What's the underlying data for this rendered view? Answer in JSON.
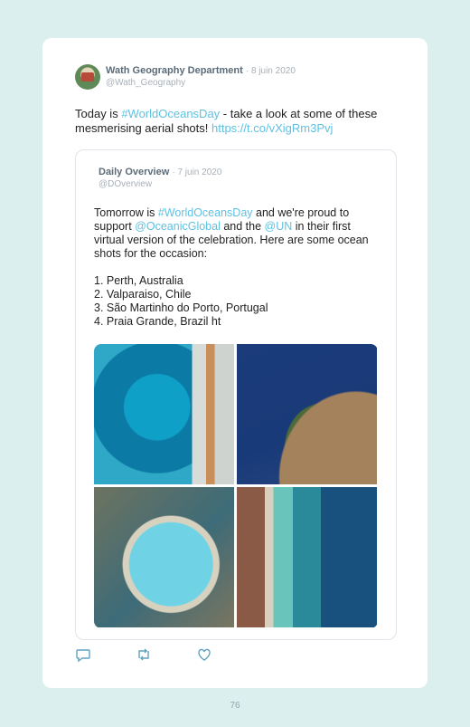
{
  "tweet": {
    "author_name": "Wath Geography Department",
    "date": "· 8 juin 2020",
    "handle": "@Wath_Geography",
    "text_1": "Today is ",
    "hashtag": "#WorldOceansDay",
    "text_2": " - take a look at some of these mesmerising aerial shots! ",
    "link": "https://t.co/vXigRm3Pvj"
  },
  "quoted": {
    "author_name": "Daily Overview",
    "date": "· 7 juin 2020",
    "handle": "@DOverview",
    "text_1": "Tomorrow is ",
    "hashtag": "#WorldOceansDay",
    "text_2": " and we're proud to support ",
    "mention_1": "@OceanicGlobal",
    "text_3": " and the ",
    "mention_2": "@UN",
    "text_4": " in their first virtual version of the celebration. Here are some ocean shots for the occasion:",
    "list": [
      "1. Perth, Australia",
      "2. Valparaiso, Chile",
      "3. São Martinho do Porto, Portugal",
      "4. Praia Grande, Brazil ht"
    ]
  },
  "actions": {
    "reply": "reply-icon",
    "retweet": "retweet-icon",
    "like": "heart-icon"
  },
  "page_number": "76",
  "colors": {
    "link": "#5fc1e2",
    "background": "#dcefef"
  }
}
